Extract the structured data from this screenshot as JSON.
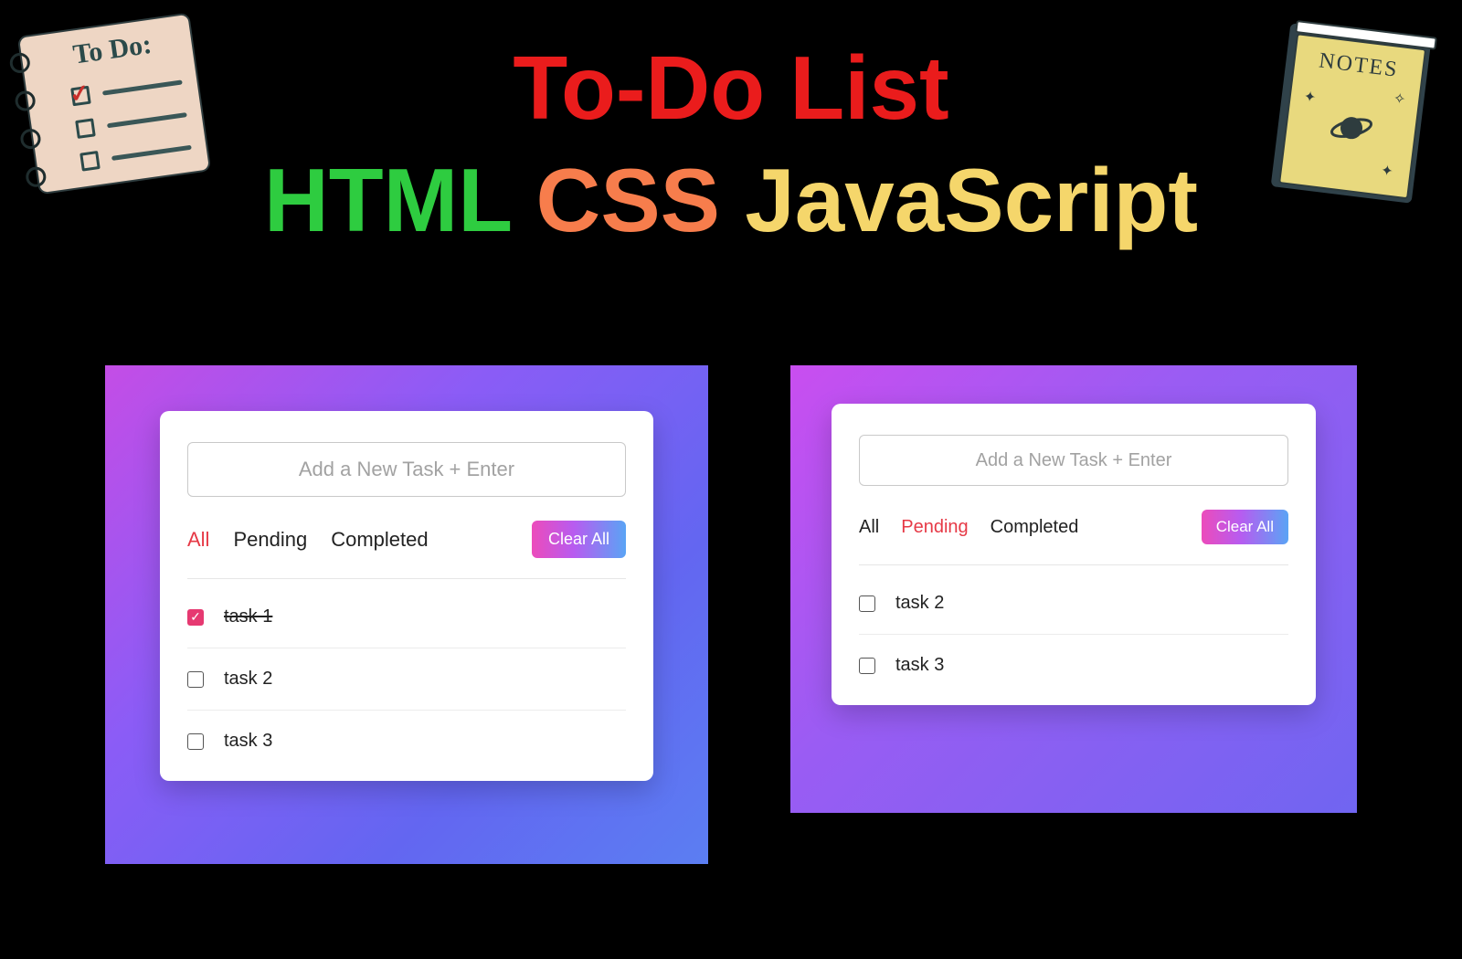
{
  "header": {
    "title": "To-Do List",
    "word_html": "HTML",
    "word_css": "CSS",
    "word_js": "JavaScript"
  },
  "illustrations": {
    "todo_label": "To Do:",
    "notes_label": "NOTES"
  },
  "panel_left": {
    "input_placeholder": "Add a New Task + Enter",
    "filters": {
      "all": "All",
      "pending": "Pending",
      "completed": "Completed",
      "active": "all"
    },
    "clear_label": "Clear All",
    "tasks": [
      {
        "label": "task 1",
        "done": true
      },
      {
        "label": "task 2",
        "done": false
      },
      {
        "label": "task 3",
        "done": false
      }
    ]
  },
  "panel_right": {
    "input_placeholder": "Add a New Task + Enter",
    "filters": {
      "all": "All",
      "pending": "Pending",
      "completed": "Completed",
      "active": "pending"
    },
    "clear_label": "Clear All",
    "tasks": [
      {
        "label": "task 2",
        "done": false
      },
      {
        "label": "task 3",
        "done": false
      }
    ]
  }
}
